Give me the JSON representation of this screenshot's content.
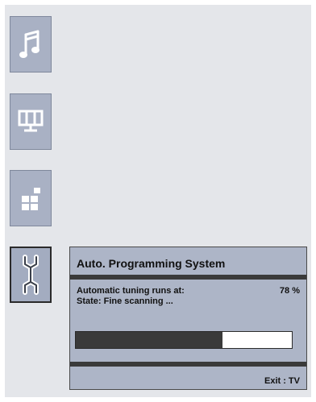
{
  "menu": {
    "items": [
      {
        "icon": "music-note-icon",
        "selected": false
      },
      {
        "icon": "picture-screen-icon",
        "selected": false
      },
      {
        "icon": "channel-blocks-icon",
        "selected": false
      },
      {
        "icon": "wrench-setup-icon",
        "selected": true
      }
    ]
  },
  "dialog": {
    "title": "Auto. Programming System",
    "tuning_label": "Automatic tuning runs at:",
    "tuning_value": "78 %",
    "state_text": "State: Fine scanning ...",
    "progress_fraction": 0.68,
    "exit_label": "Exit : TV"
  },
  "colors": {
    "background": "#e4e6ea",
    "panel": "#adb5c7",
    "dark_bar": "#3a3a3a"
  }
}
